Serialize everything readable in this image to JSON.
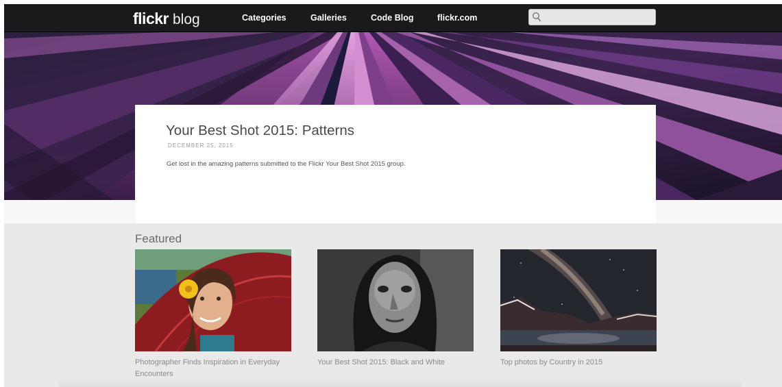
{
  "header": {
    "logo_bold": "flickr",
    "logo_light": "blog",
    "nav": [
      "Categories",
      "Galleries",
      "Code Blog",
      "flickr.com"
    ],
    "search_placeholder": ""
  },
  "hero": {
    "title": "Your Best Shot 2015: Patterns",
    "date": "DECEMBER 25, 2015",
    "summary": "Get lost in the amazing patterns submitted to the Flickr Your Best Shot 2015 group."
  },
  "featured": {
    "heading": "Featured",
    "items": [
      {
        "caption": "Photographer Finds Inspiration in Everyday Encounters"
      },
      {
        "caption": "Your Best Shot 2015: Black and White"
      },
      {
        "caption": "Top photos by Country in 2015"
      }
    ]
  },
  "colors": {
    "topbar": "#1a1a1c",
    "hero_purple": "#7b3f8c",
    "page_bg": "#e9e9e9"
  }
}
